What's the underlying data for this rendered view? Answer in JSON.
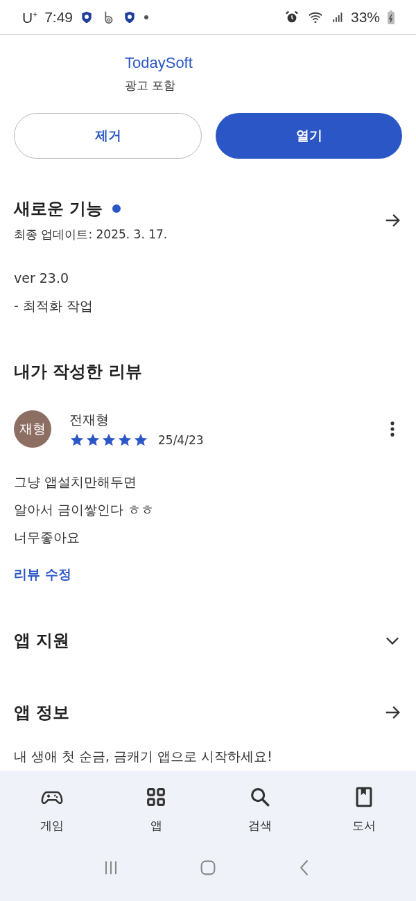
{
  "status_bar": {
    "carrier": "U⁺",
    "time": "7:49",
    "battery": "33%"
  },
  "app": {
    "developer": "TodaySoft",
    "ads_note": "광고 포함"
  },
  "actions": [
    {
      "kind": "outline",
      "label": "제거"
    },
    {
      "kind": "filled",
      "label": "열기"
    }
  ],
  "whats_new": {
    "title": "새로운 기능",
    "new_dot": true,
    "updated": "최종 업데이트: 2025. 3. 17.",
    "notes": [
      "ver 23.0",
      "- 최적화 작업"
    ]
  },
  "my_review": {
    "title": "내가 작성한 리뷰",
    "avatar": "재형",
    "author": "전재형",
    "stars": 5,
    "date": "25/4/23",
    "lines": [
      "그냥 앱설치만해두면",
      "알아서 금이쌓인다 ㅎㅎ",
      "너무좋아요"
    ],
    "edit_link": "리뷰 수정"
  },
  "sections": [
    {
      "kind": "expand",
      "title": "앱 지원",
      "expanded": false
    },
    {
      "kind": "link",
      "title": "앱 정보",
      "description": "내 생애 첫 순금, 금캐기 앱으로 시작하세요!"
    }
  ],
  "bottom_nav": [
    {
      "kind": "games",
      "label": "게임",
      "selected": false
    },
    {
      "kind": "apps",
      "label": "앱",
      "selected": false
    },
    {
      "kind": "search",
      "label": "검색",
      "selected": false
    },
    {
      "kind": "books",
      "label": "도서",
      "selected": false
    }
  ]
}
